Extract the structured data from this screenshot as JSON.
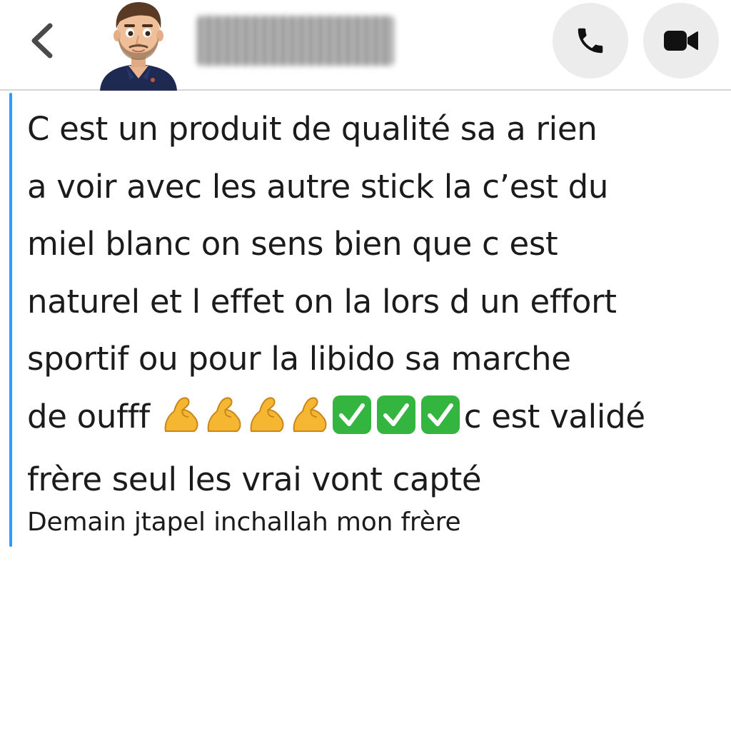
{
  "header": {
    "back_icon": "chevron-left-icon",
    "avatar_icon": "bitmoji-avatar",
    "contact_name": "",
    "call_icon": "phone-icon",
    "video_icon": "video-camera-icon"
  },
  "conversation": {
    "sender_color": "#2f9bff",
    "messages": [
      {
        "line_1": "C est un produit de qualité sa a rien",
        "line_2": "a voir avec les autre stick la c’est du",
        "line_3": "miel blanc on sens bien que c est",
        "line_4": "naturel et l effet on la lors d un effort",
        "line_5": "sportif ou pour la libido sa marche",
        "line_6_start": "de oufff",
        "emojis_flexed": "💪💪💪💪",
        "emojis_check": "✅✅✅",
        "line_6_end": "c est validé",
        "line_7": "frère seul les vrai vont capté"
      },
      {
        "text": "Demain jtapel inchallah mon frère"
      }
    ]
  }
}
